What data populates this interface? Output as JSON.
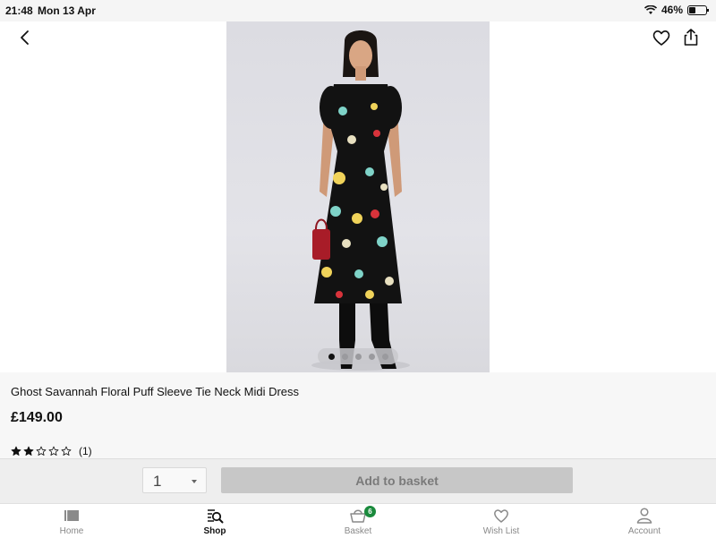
{
  "status_bar": {
    "time": "21:48",
    "date": "Mon 13 Apr",
    "battery": "46%",
    "battery_level": 0.46
  },
  "header": {
    "back_icon": "chevron-left-icon",
    "wishlist_icon": "heart-icon",
    "share_icon": "share-icon"
  },
  "gallery": {
    "image_count": 5,
    "active_index": 0
  },
  "product": {
    "title": "Ghost Savannah Floral Puff Sleeve Tie Neck Midi Dress",
    "price": "£149.00",
    "rating_stars": 2,
    "rating_max": 5,
    "review_count": "(1)"
  },
  "purchase": {
    "quantity": "1",
    "add_to_basket_label": "Add to basket"
  },
  "tabs": [
    {
      "label": "Home",
      "icon": "home-icon",
      "active": false
    },
    {
      "label": "Shop",
      "icon": "shop-search-icon",
      "active": true
    },
    {
      "label": "Basket",
      "icon": "basket-icon",
      "active": false,
      "badge": "6"
    },
    {
      "label": "Wish List",
      "icon": "heart-icon",
      "active": false
    },
    {
      "label": "Account",
      "icon": "person-icon",
      "active": false
    }
  ],
  "colors": {
    "badge": "#1a8a3c",
    "add_button_bg": "#c7c7c7",
    "add_button_text": "#7a7a7a"
  }
}
